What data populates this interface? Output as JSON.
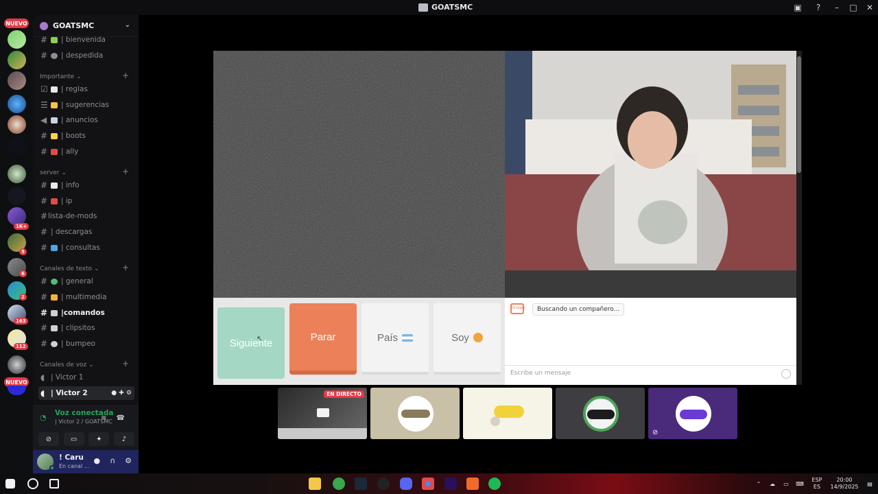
{
  "window": {
    "title": "GOATSMC"
  },
  "rail": {
    "badges": [
      "NUEVO",
      "1K+",
      "5",
      "6",
      "2",
      "163",
      "112",
      "NUEVO"
    ]
  },
  "server": {
    "name": "GOATSMC"
  },
  "channels_top": [
    {
      "name": "| bienvenida",
      "emoji": "#8fce4a"
    },
    {
      "name": "| despedida",
      "emoji": "#8d8f95"
    }
  ],
  "categories": {
    "importante": "Importante",
    "server": "server",
    "texto": "Canales de texto",
    "voz": "Canales de voz"
  },
  "channels_importante": [
    {
      "name": "| reglas",
      "emoji": "#e8e8e8"
    },
    {
      "name": "| sugerencias",
      "emoji": "#f7c24a"
    },
    {
      "name": "| anuncios",
      "emoji": "#c7d6e3"
    },
    {
      "name": "| boots",
      "emoji": "#f7d34a"
    },
    {
      "name": "| ally",
      "emoji": "#e24a4a"
    }
  ],
  "channels_server": [
    {
      "name": "| info",
      "emoji": "#e8e8e8"
    },
    {
      "name": "| ip",
      "emoji": "#e24a4a"
    },
    {
      "name": "lista-de-mods",
      "emoji": ""
    },
    {
      "name": "| descargas",
      "emoji": ""
    },
    {
      "name": "| consultas",
      "emoji": "#4ea5e6"
    }
  ],
  "channels_texto": [
    {
      "name": "| general",
      "emoji": "#4ac07a"
    },
    {
      "name": "| multimedia",
      "emoji": "#f2b23a"
    },
    {
      "name": "|comandos",
      "emoji": "#cfd0d4",
      "active": true
    },
    {
      "name": "| clipsitos",
      "emoji": "#cfd0d4"
    },
    {
      "name": "| bumpeo",
      "emoji": "#cfd0d4"
    }
  ],
  "channels_voz": [
    {
      "name": "| Victor 1"
    },
    {
      "name": "| Victor 2",
      "active": true
    }
  ],
  "voice": {
    "status": "Voz conectada",
    "location": "| Victor 2 / GOATSMC"
  },
  "user": {
    "name": "! Caru",
    "status": "En canal ..."
  },
  "omegle": {
    "buttons": {
      "next": "Siguiente",
      "stop": "Parar",
      "country": "País",
      "gender": "Soy"
    },
    "chat_status": "Buscando un compañero...",
    "chat_placeholder": "Escribe un mensaje",
    "logo_text": "Omegle"
  },
  "tiles": {
    "live_label": "EN DIRECTO"
  },
  "taskbar": {
    "lang1": "ESP",
    "lang2": "ES",
    "time": "20:00",
    "date": "14/9/2025"
  }
}
